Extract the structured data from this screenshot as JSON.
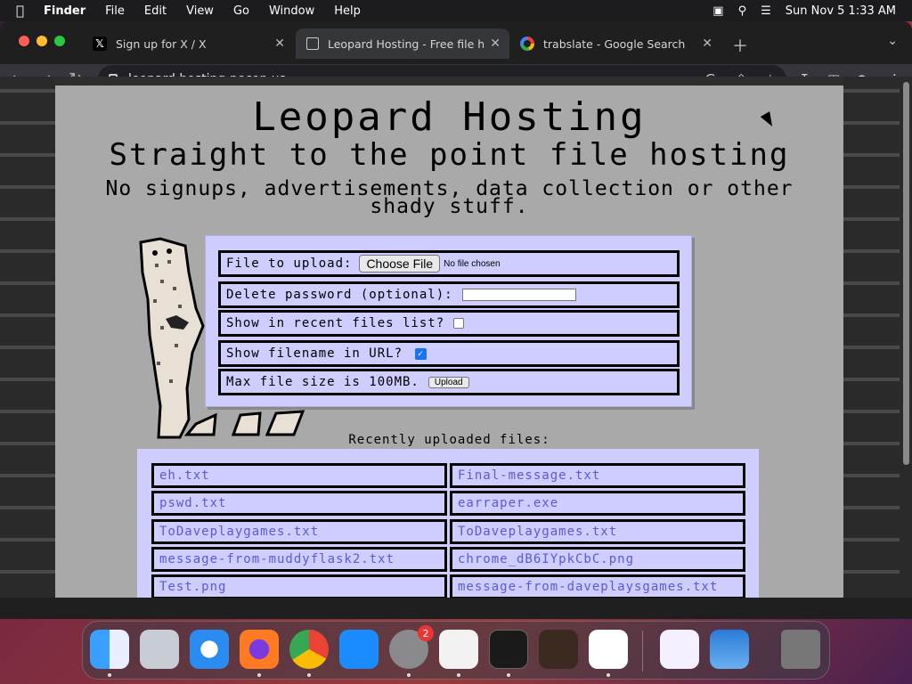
{
  "menubar": {
    "app": "Finder",
    "items": [
      "File",
      "Edit",
      "View",
      "Go",
      "Window",
      "Help"
    ],
    "clock": "Sun Nov 5  1:33 AM"
  },
  "browser": {
    "tabs": [
      {
        "title": "Sign up for X / X",
        "icon": "x-logo-icon"
      },
      {
        "title": "Leopard Hosting - Free file ho",
        "icon": "page-icon",
        "active": true
      },
      {
        "title": "trabslate - Google Search",
        "icon": "google-icon"
      }
    ],
    "url": "leopard.hosting.pecon.us"
  },
  "page": {
    "title": "Leopard Hosting",
    "subtitle": "Straight to the point file hosting",
    "tagline": "No signups, advertisements, data collection or other shady stuff.",
    "form": {
      "file_label": "File to upload:",
      "choose_button": "Choose File",
      "no_file": "No file chosen",
      "delete_label": "Delete password (optional):",
      "recent_label": "Show in recent files list?",
      "recent_checked": false,
      "filename_label": "Show filename in URL?",
      "filename_checked": true,
      "max_label": "Max file size is 100MB.",
      "upload_button": "Upload"
    },
    "recent_heading": "Recently uploaded files:",
    "files": [
      [
        "eh.txt",
        "Final-message.txt"
      ],
      [
        "pswd.txt",
        "earraper.exe"
      ],
      [
        "ToDaveplaygames.txt",
        "ToDaveplaygames.txt"
      ],
      [
        "message-from-muddyflask2.txt",
        "chrome_dB6IYpkCbC.png"
      ],
      [
        "Test.png",
        "message-from-daveplaysgames.txt"
      ]
    ]
  },
  "dock": {
    "apps": [
      "finder",
      "launchpad",
      "safari",
      "firefox",
      "chrome",
      "app-store",
      "system-settings",
      "textedit",
      "terminal",
      "garageband",
      "vscode",
      "visual-studio",
      "weather",
      "trash"
    ],
    "settings_badge": "2"
  },
  "colors": {
    "page_bg": "#a9a9a9",
    "form_bg": "#cfccff",
    "link": "#5b5bd6"
  }
}
